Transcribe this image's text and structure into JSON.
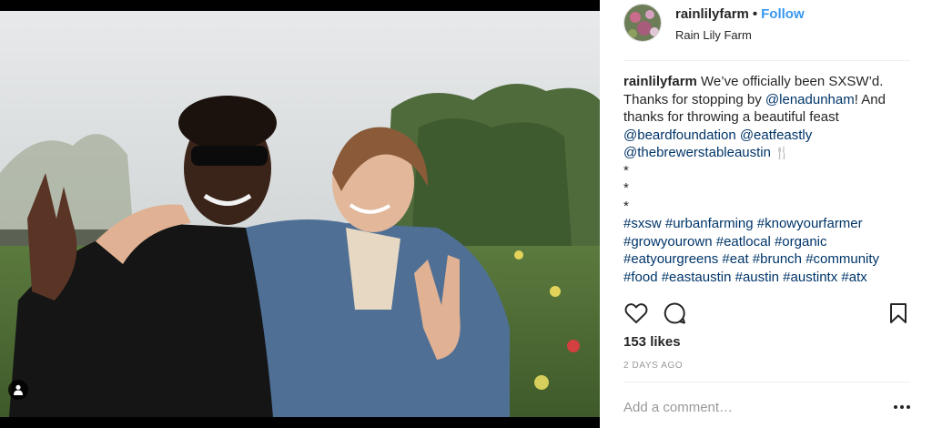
{
  "post": {
    "photo_description_icon": "photo",
    "user_tag_icon": "person-icon"
  },
  "header": {
    "username": "rainlilyfarm",
    "separator": "•",
    "follow_label": "Follow",
    "location": "Rain Lily Farm"
  },
  "caption": {
    "username": "rainlilyfarm",
    "text_1": " We’ve officially been SXSW’d.",
    "text_2": "Thanks for stopping by ",
    "mention_lena": "@lenadunham",
    "text_2b": "! And",
    "text_3": "thanks for throwing a beautiful feast",
    "mention_beard": "@beardfoundation",
    "mention_eatfeastly": "@eatfeastly",
    "mention_brewers": "@thebrewerstableaustin",
    "fork_emoji": "🍴",
    "star_1": "*",
    "star_2": "*",
    "star_3": "*",
    "hashtags_line_1": [
      "#sxsw",
      "#urbanfarming",
      "#knowyourfarmer"
    ],
    "hashtags_line_2": [
      "#growyourown",
      "#eatlocal",
      "#organic"
    ],
    "hashtags_line_3": [
      "#eatyourgreens",
      "#eat",
      "#brunch",
      "#community"
    ],
    "hashtags_line_4": [
      "#food",
      "#eastaustin",
      "#austin",
      "#austintx",
      "#atx"
    ]
  },
  "actions": {
    "like_icon": "heart-icon",
    "comment_icon": "comment-bubble-icon",
    "save_icon": "bookmark-icon"
  },
  "likes": "153 likes",
  "date": "2 DAYS AGO",
  "comment": {
    "placeholder": "Add a comment…",
    "value": "",
    "more_icon": "ellipsis-icon"
  },
  "colors": {
    "link": "#003569",
    "follow": "#3897f0",
    "muted": "#999999",
    "text": "#262626"
  }
}
